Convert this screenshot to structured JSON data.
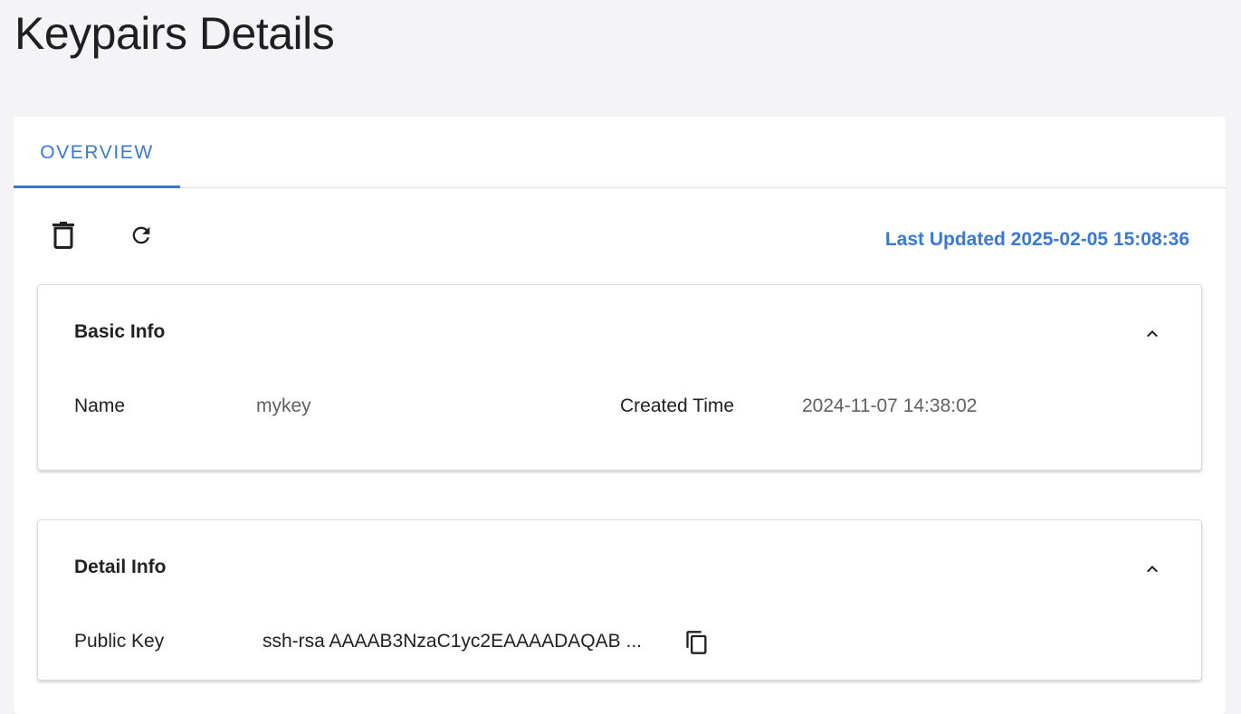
{
  "page": {
    "title": "Keypairs Details"
  },
  "tabs": [
    {
      "label": "OVERVIEW",
      "active": true
    }
  ],
  "toolbar": {
    "delete_icon": "delete-icon",
    "refresh_icon": "refresh-icon",
    "last_updated": "Last Updated 2025-02-05 15:08:36"
  },
  "basic_info": {
    "title": "Basic Info",
    "collapse_icon": "chevron-up-icon",
    "name_label": "Name",
    "name_value": "mykey",
    "created_label": "Created Time",
    "created_value": "2024-11-07 14:38:02"
  },
  "detail_info": {
    "title": "Detail Info",
    "collapse_icon": "chevron-up-icon",
    "public_key_label": "Public Key",
    "public_key_value": "ssh-rsa AAAAB3NzaC1yc2EAAAADAQAB ...",
    "copy_icon": "copy-icon"
  },
  "colors": {
    "accent": "#3a78d6",
    "background": "#f4f4f6",
    "card": "#ffffff"
  }
}
